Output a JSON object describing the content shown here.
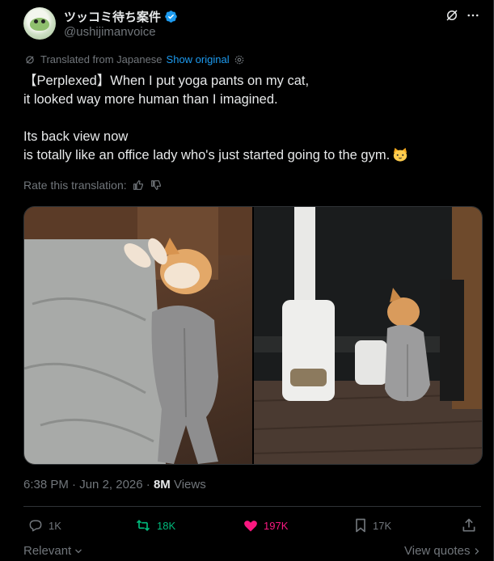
{
  "author": {
    "display_name": "ツッコミ待ち案件",
    "handle": "@ushijimanvoice",
    "verified": true
  },
  "translation": {
    "source_label": "Translated from Japanese",
    "show_original_label": "Show original"
  },
  "tweet": {
    "line1": "【Perplexed】When I put yoga pants on my cat,",
    "line2": "it looked way more human than I imagined.",
    "line3": "Its back view now",
    "line4": "is totally like an office lady who's just started going to the gym."
  },
  "rate_label": "Rate this translation:",
  "media": {
    "photo_left": "cat in gray yoga pants lying on a bed",
    "photo_right": "cat in gray yoga pants sitting by a window"
  },
  "meta": {
    "time": "6:38 PM",
    "date": "Jun 2, 2026",
    "views_count": "8M",
    "views_label": "Views"
  },
  "actions": {
    "replies": "1K",
    "reposts": "18K",
    "likes": "197K",
    "bookmarks": "17K"
  },
  "footer": {
    "relevant": "Relevant",
    "view_quotes": "View quotes"
  },
  "colors": {
    "accent": "#1d9bf0",
    "repost": "#00ba7c",
    "like": "#f91880",
    "muted": "#71767b"
  }
}
